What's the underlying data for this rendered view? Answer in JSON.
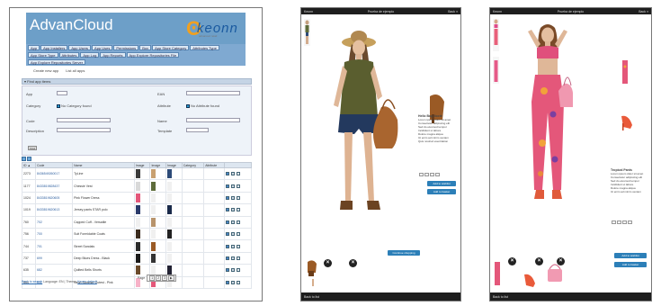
{
  "admin": {
    "brand": "AdvanCloud",
    "logo": {
      "mark": "ʘ",
      "text": "keonn",
      "tagline": "advanced retail"
    },
    "nav_row1": [
      "App",
      "App Installers",
      "App Users",
      "App Uses",
      "Permissions",
      "Box",
      "App Store Category",
      "Attributes Type"
    ],
    "nav_row2": [
      "App Store Type",
      "Attributes",
      "App Log",
      "App Reports",
      "App Explore Repositories File"
    ],
    "nav_row3": [
      "App Explore Repositories Server"
    ],
    "subtabs": [
      "Create new app",
      "List all apps"
    ],
    "section_title": "▾ Find app items",
    "form": {
      "app_label": "App",
      "category_label": "Category",
      "category_check": "No Category found",
      "code_label": "Code",
      "description_label": "Description",
      "ean_label": "EAN",
      "attribute_label": "Attribute",
      "attribute_check": "No Attribute found",
      "name_label": "Name",
      "template_label": "Template",
      "find_button": "Find"
    },
    "columns": [
      "ID ▲",
      "Code",
      "Name",
      "Image",
      "Image",
      "Image",
      "Category",
      "Attribute",
      ""
    ],
    "rows": [
      {
        "id": "2273",
        "code": "8436549260017",
        "name": "TyLine"
      },
      {
        "id": "1177",
        "code": "8433819828437",
        "name": "Chessie Vest"
      },
      {
        "id": "1024",
        "code": "8433819620605",
        "name": "Pink Flower Dress"
      },
      {
        "id": "1019",
        "code": "8433819620613",
        "name": "Jersey pants STAR polo"
      },
      {
        "id": "760",
        "code": "702",
        "name": "Capped Cuff - Versatile"
      },
      {
        "id": "756",
        "code": "700",
        "name": "Suit Formidable Coats"
      },
      {
        "id": "744",
        "code": "701",
        "name": "Street Sandals"
      },
      {
        "id": "737",
        "code": "699",
        "name": "Deep Blues Dress - Black"
      },
      {
        "id": "635",
        "code": "682",
        "name": "Quilted Bells Shorts"
      },
      {
        "id": "554",
        "code": "631",
        "name": "Neon Summer Cutest - Pink"
      }
    ],
    "pager_label": "Page",
    "pager_items": [
      "1",
      "2",
      "3",
      "▶"
    ],
    "footer": {
      "prefix": "",
      "link1": "Back to search",
      "mid": "Language:",
      "lang": "EN",
      "theme_label": "| Theme:",
      "link2": "Keonn default"
    }
  },
  "mobile_left": {
    "top_left": "Keonn",
    "top_center": "Prueba de ejemplo",
    "top_right": "Back ≡",
    "bottom_left": "Back to list",
    "title": "Hello Bag Nocté",
    "details": [
      "Lorem ipsum dolor sit amet",
      "Consectetur adipiscing elit",
      "Sed do eiusmod tempor",
      "Incididunt ut labore",
      "Dolore magna aliqua",
      "Ut enim ad minim veniam",
      "Quis nostrud exercitation"
    ],
    "buttons": [
      "Add to wishlist",
      "Add to basket"
    ],
    "bottom_button": "Continue shopping"
  },
  "mobile_right": {
    "top_left": "Keonn",
    "top_center": "Prueba de ejemplo",
    "top_right": "Back ≡",
    "bottom_left": "Back to list",
    "title": "Tropical Pants",
    "details": [
      "Lorem ipsum dolor sit amet",
      "Consectetur adipiscing elit",
      "Sed do eiusmod tempor",
      "Incididunt ut labore",
      "Dolore magna aliqua",
      "Ut enim ad minim veniam"
    ],
    "buttons": [
      "Add to wishlist",
      "Add to basket"
    ]
  },
  "colors": {
    "header": "#6d9fc8",
    "nav": "#7fa9d1",
    "mobile_button": "#2c7fb8",
    "bar": "#1e1e1e"
  }
}
